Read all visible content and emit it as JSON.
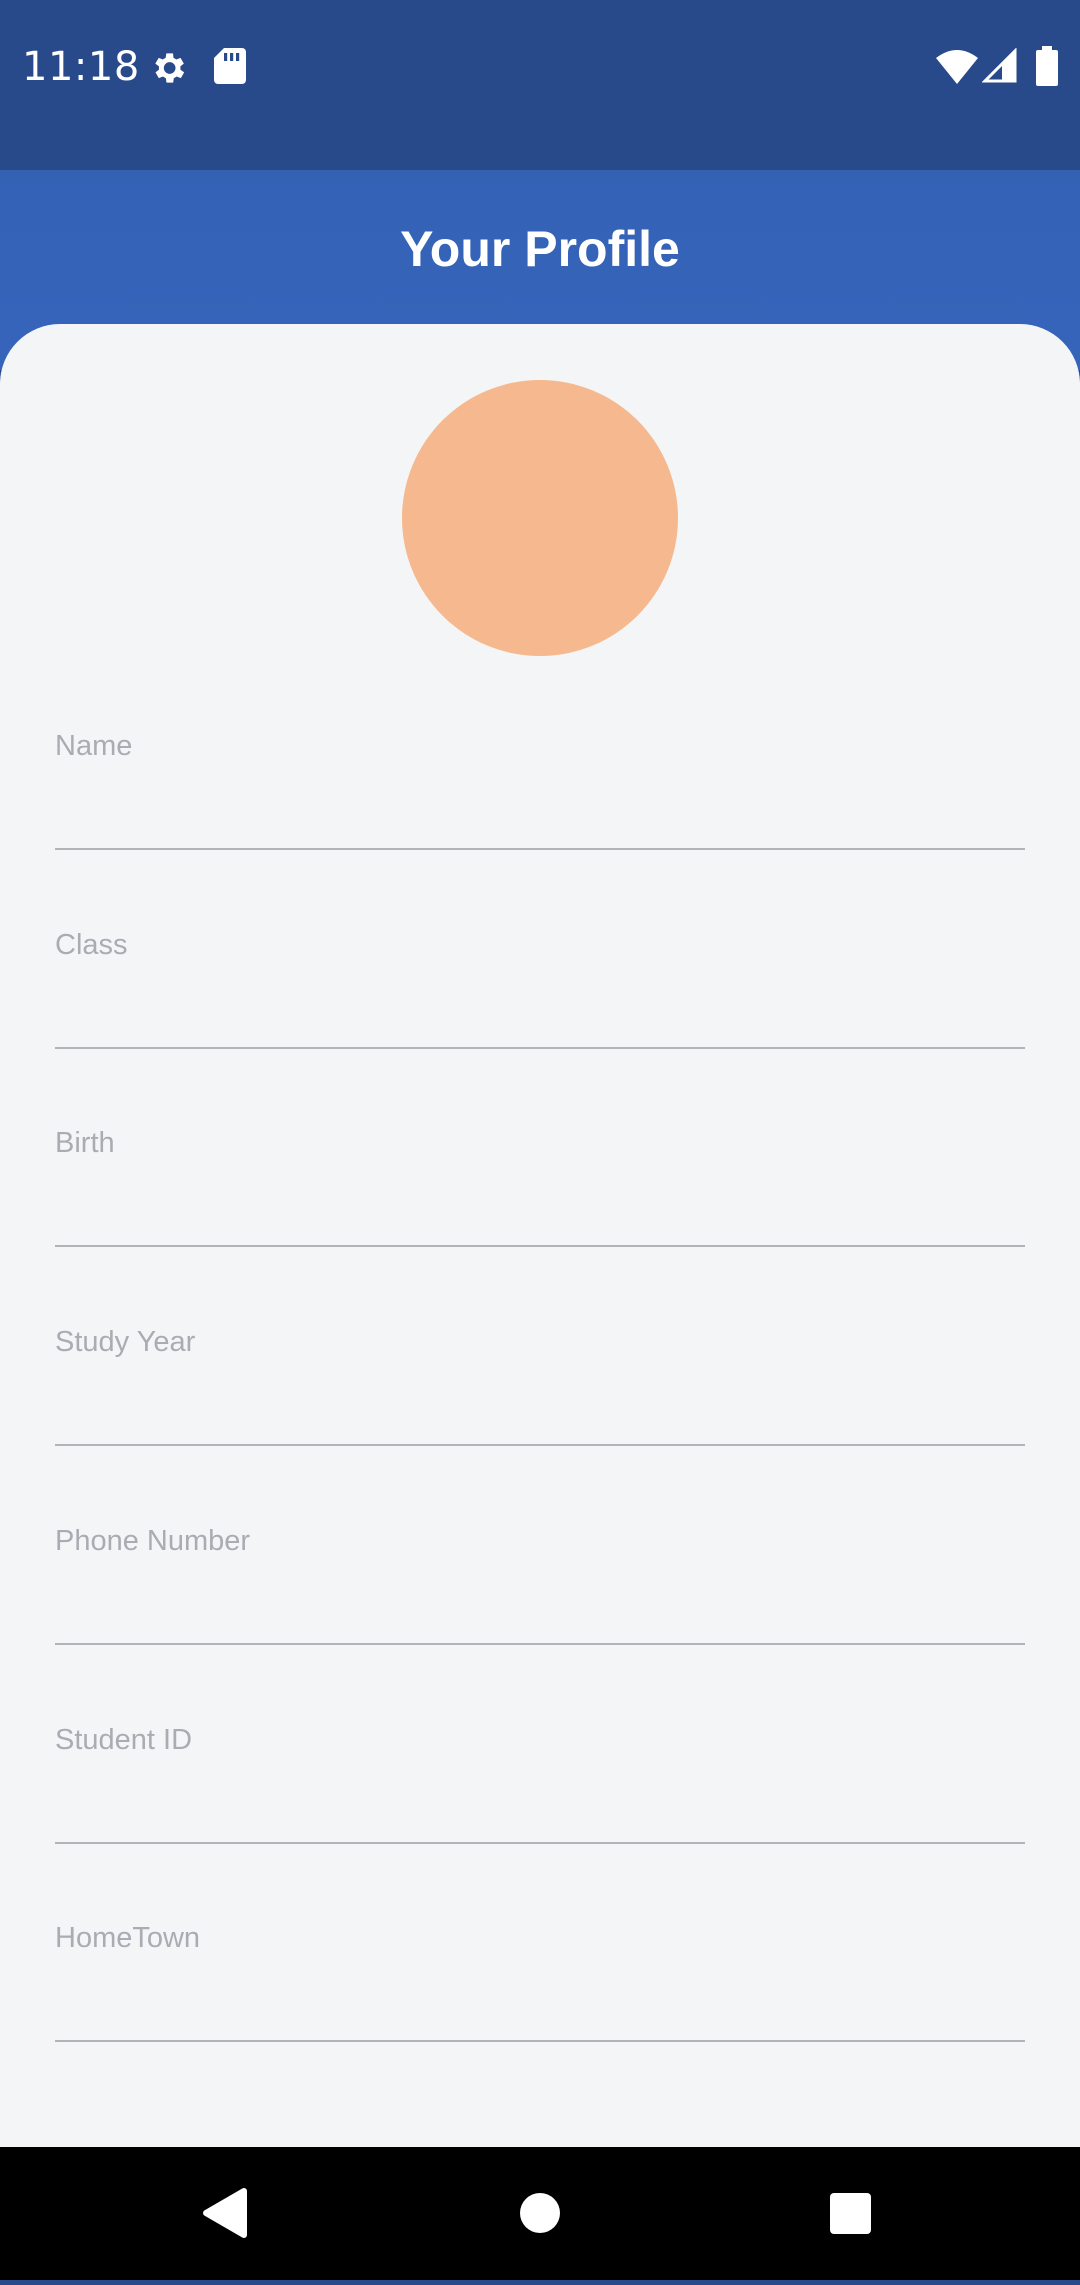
{
  "status_bar": {
    "time": "11:18",
    "icons": [
      "gear-icon",
      "sd-card-icon",
      "wifi-icon",
      "cell-signal-icon",
      "battery-icon"
    ]
  },
  "app_bar": {
    "title": "Your Profile"
  },
  "profile": {
    "avatar_color": "#f6b88e",
    "fields": [
      {
        "label": "Name",
        "value": ""
      },
      {
        "label": "Class",
        "value": ""
      },
      {
        "label": "Birth",
        "value": ""
      },
      {
        "label": "Study Year",
        "value": ""
      },
      {
        "label": "Phone Number",
        "value": ""
      },
      {
        "label": "Student ID",
        "value": ""
      },
      {
        "label": "HomeTown",
        "value": ""
      }
    ]
  },
  "nav_bar": {
    "buttons": [
      "back-icon",
      "home-icon",
      "recents-icon"
    ]
  },
  "colors": {
    "status_bar": "#294a8a",
    "app_bar": "#3664bb",
    "content_bg": "#f4f5f7",
    "label": "#a9adb3",
    "underline": "#b2b4b8"
  }
}
